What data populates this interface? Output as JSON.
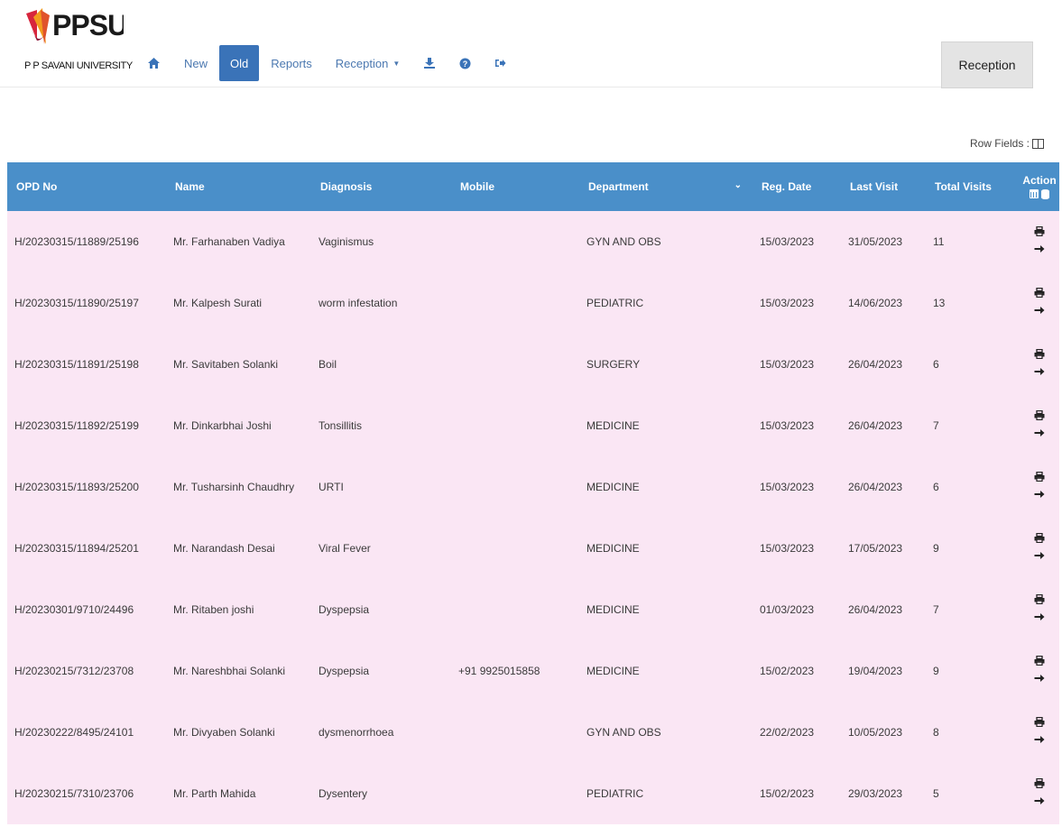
{
  "brand": {
    "name": "PPSU",
    "subtitle": "P P SAVANI UNIVERSITY",
    "accent": "#3a73b8"
  },
  "nav": {
    "home_icon": "home-icon",
    "items": [
      {
        "label": "New",
        "active": false
      },
      {
        "label": "Old",
        "active": true
      },
      {
        "label": "Reports",
        "active": false
      },
      {
        "label": "Reception",
        "active": false,
        "dropdown": true
      }
    ],
    "icons": [
      "download-icon",
      "help-icon",
      "logout-icon"
    ]
  },
  "user_role": "Reception",
  "row_fields_label": "Row Fields :",
  "table": {
    "header_color": "#4a8fc9",
    "row_color": "#fae6f4",
    "columns": {
      "opd": "OPD No",
      "name": "Name",
      "diagnosis": "Diagnosis",
      "mobile": "Mobile",
      "department": "Department",
      "reg_date": "Reg. Date",
      "last_visit": "Last Visit",
      "total_visits": "Total Visits",
      "action": "Action"
    },
    "rows": [
      {
        "opd": "H/20230315/11889/25196",
        "name": "Mr. Farhanaben Vadiya",
        "diagnosis": "Vaginismus",
        "mobile": "",
        "department": "GYN AND OBS",
        "reg_date": "15/03/2023",
        "last_visit": "31/05/2023",
        "total_visits": "11"
      },
      {
        "opd": "H/20230315/11890/25197",
        "name": "Mr. Kalpesh Surati",
        "diagnosis": "worm infestation",
        "mobile": "",
        "department": "PEDIATRIC",
        "reg_date": "15/03/2023",
        "last_visit": "14/06/2023",
        "total_visits": "13"
      },
      {
        "opd": "H/20230315/11891/25198",
        "name": "Mr. Savitaben Solanki",
        "diagnosis": "Boil",
        "mobile": "",
        "department": "SURGERY",
        "reg_date": "15/03/2023",
        "last_visit": "26/04/2023",
        "total_visits": "6"
      },
      {
        "opd": "H/20230315/11892/25199",
        "name": "Mr. Dinkarbhai Joshi",
        "diagnosis": "Tonsillitis",
        "mobile": "",
        "department": "MEDICINE",
        "reg_date": "15/03/2023",
        "last_visit": "26/04/2023",
        "total_visits": "7"
      },
      {
        "opd": "H/20230315/11893/25200",
        "name": "Mr. Tusharsinh Chaudhry",
        "diagnosis": "URTI",
        "mobile": "",
        "department": "MEDICINE",
        "reg_date": "15/03/2023",
        "last_visit": "26/04/2023",
        "total_visits": "6"
      },
      {
        "opd": "H/20230315/11894/25201",
        "name": "Mr. Narandash Desai",
        "diagnosis": "Viral Fever",
        "mobile": "",
        "department": "MEDICINE",
        "reg_date": "15/03/2023",
        "last_visit": "17/05/2023",
        "total_visits": "9"
      },
      {
        "opd": "H/20230301/9710/24496",
        "name": "Mr. Ritaben joshi",
        "diagnosis": "Dyspepsia",
        "mobile": "",
        "department": "MEDICINE",
        "reg_date": "01/03/2023",
        "last_visit": "26/04/2023",
        "total_visits": "7"
      },
      {
        "opd": "H/20230215/7312/23708",
        "name": "Mr. Nareshbhai Solanki",
        "diagnosis": "Dyspepsia",
        "mobile": "+91 9925015858",
        "department": "MEDICINE",
        "reg_date": "15/02/2023",
        "last_visit": "19/04/2023",
        "total_visits": "9"
      },
      {
        "opd": "H/20230222/8495/24101",
        "name": "Mr. Divyaben Solanki",
        "diagnosis": "dysmenorrhoea",
        "mobile": "",
        "department": "GYN AND OBS",
        "reg_date": "22/02/2023",
        "last_visit": "10/05/2023",
        "total_visits": "8"
      },
      {
        "opd": "H/20230215/7310/23706",
        "name": "Mr. Parth Mahida",
        "diagnosis": "Dysentery",
        "mobile": "",
        "department": "PEDIATRIC",
        "reg_date": "15/02/2023",
        "last_visit": "29/03/2023",
        "total_visits": "5"
      }
    ],
    "row_actions": [
      "printer-icon",
      "arrow-right-icon"
    ]
  }
}
